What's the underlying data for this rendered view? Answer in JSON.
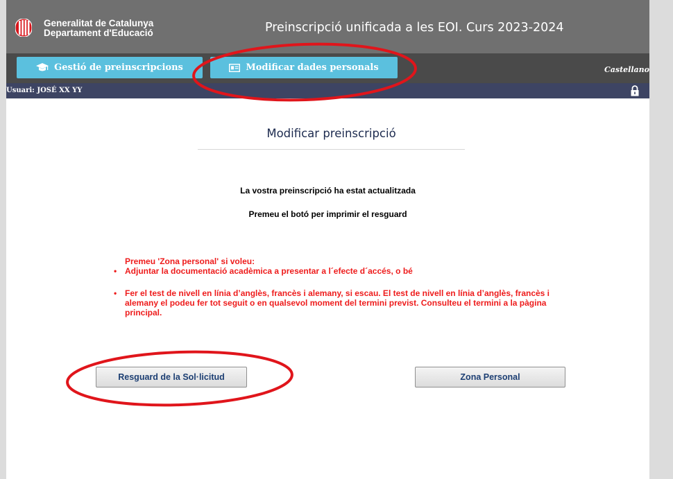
{
  "header": {
    "org_line1": "Generalitat de Catalunya",
    "org_line2": "Departament d'Educació",
    "title": "Preinscripció unificada a les EOI. Curs 2023-2024"
  },
  "nav": {
    "gestio_label": "Gestió de preinscripcions",
    "modificar_label": "Modificar dades personals",
    "language_link": "Castellano"
  },
  "userbar": {
    "user_text": "Usuari: JOSÉ XX YY"
  },
  "main": {
    "title": "Modificar preinscripció",
    "message1": "La vostra preinscripció ha estat actualitzada",
    "message2": "Premeu el botó per imprimir el resguard",
    "notice_intro": "Premeu 'Zona personal' si voleu:",
    "notice_item1": "Adjuntar la documentació acadèmica a presentar a l´efecte d´accés, o bé",
    "notice_item2": "Fer el test de nivell en línia d’anglès, francès i alemany, si escau. El test de nivell en línia d’anglès, francès i alemany el podeu fer tot seguit o en qualsevol moment del termini previst. Consulteu el termini a la pàgina principal."
  },
  "buttons": {
    "resguard_label": "Resguard de la Sol·licitud",
    "zona_label": "Zona Personal"
  },
  "icons": {
    "logo": "generalitat-logo-icon",
    "gestio": "graduation-cap-icon",
    "modificar": "id-card-icon",
    "lock": "lock-icon"
  },
  "colors": {
    "header_bg": "#707070",
    "nav_bg": "#4a4a4a",
    "nav_button": "#5bc0de",
    "user_bar": "#3d4463",
    "notice_text": "#ee1c1c",
    "annotation": "#e0151b",
    "logo_red": "#d7151b"
  }
}
